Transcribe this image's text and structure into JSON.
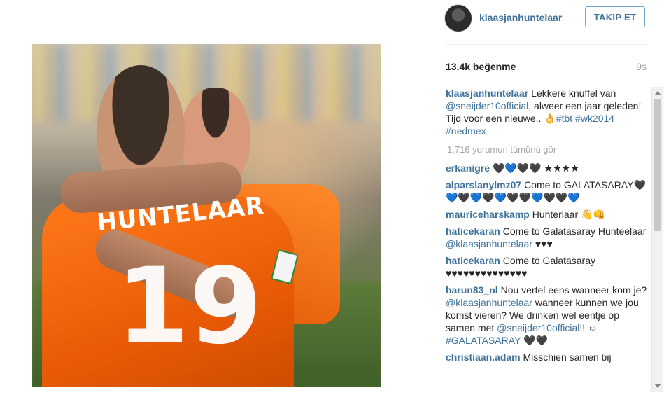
{
  "post": {
    "image_alt": "",
    "jersey_name": "HUNTELAAR",
    "jersey_number": "19"
  },
  "header": {
    "username": "klaasjanhuntelaar",
    "follow_label": "TAKİP ET"
  },
  "meta": {
    "likes": "13.4k beğenme",
    "time": "9s"
  },
  "caption": {
    "user": "klaasjanhuntelaar",
    "parts": [
      "Lekkere knuffel van ",
      "@sneijder10official",
      ", alweer een jaar geleden! Tijd voor een nieuwe.. 👌",
      "#tbt",
      " ",
      "#wk2014",
      " ",
      "#nedmex"
    ]
  },
  "view_all_label": "1,716 yorumun tümünü gör",
  "comments": [
    {
      "user": "erkanigre",
      "text": "🖤💙🖤🖤 ★★★★"
    },
    {
      "user": "alparslanylmz07",
      "text": "Come to GALATASARAY🖤💙🖤💙🖤💙🖤🖤💙🖤🖤💙"
    },
    {
      "user": "mauriceharskamp",
      "text": "Hunterlaar 👋👊"
    },
    {
      "user": "haticekaran",
      "text_a": "Come to Galatasaray Hunteelaar ",
      "mention": "@klaasjanhuntelaar",
      "text_b": " ♥♥♥"
    },
    {
      "user": "haticekaran",
      "text": "Come to Galatasaray ♥♥♥♥♥♥♥♥♥♥♥♥♥♥"
    },
    {
      "user": "harun83_nl",
      "text_a": "Nou vertel eens wanneer kom je? ",
      "mention": "@klaasjanhuntelaar",
      "text_b": " wanneer kunnen we jou komst vieren? We drinken wel eentje op samen met ",
      "mention2": "@sneijder10official",
      "text_c": "!! ☺",
      "hashtag": "#GALATASARAY",
      "text_d": " 🖤🖤"
    },
    {
      "user": "christiaan.adam",
      "text": "Misschien samen bij"
    }
  ],
  "colors": {
    "link": "#3f729b",
    "muted": "#a5a7aa",
    "follow_border": "#70a7d1"
  },
  "icons": [
    "scroll-up-arrow-icon",
    "scroll-down-arrow-icon"
  ]
}
